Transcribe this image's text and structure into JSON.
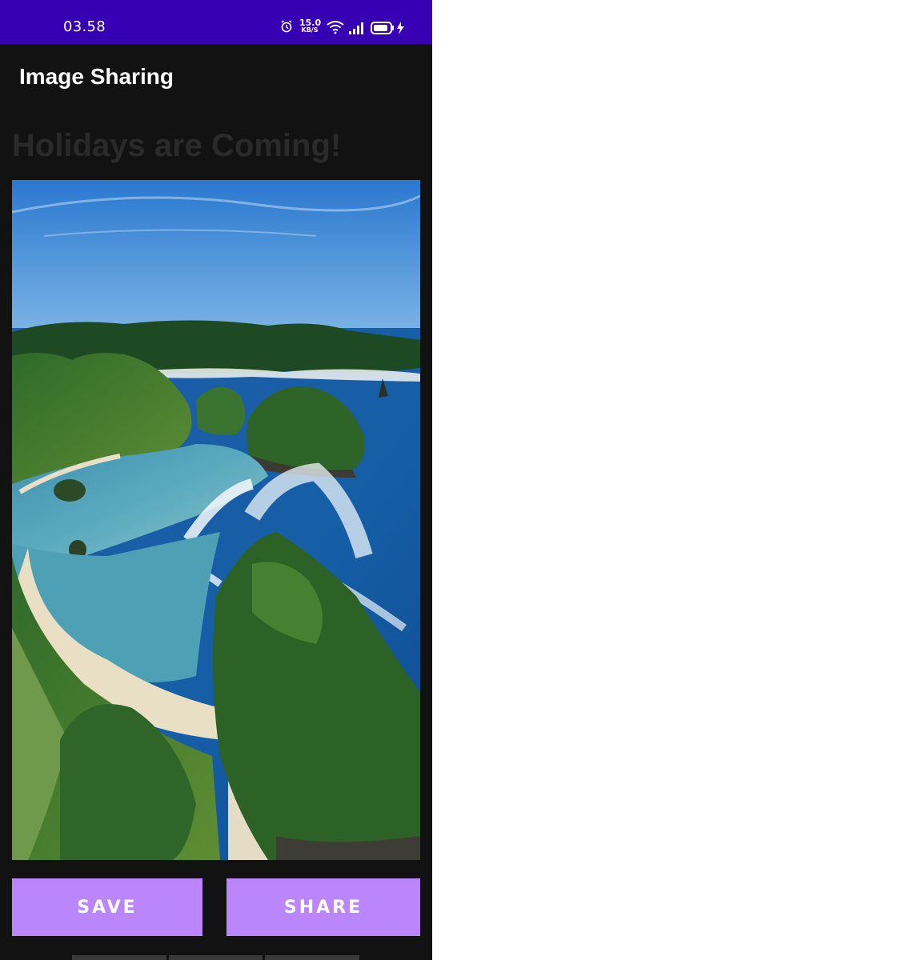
{
  "status_bar": {
    "time": "03.58",
    "net_speed_value": "15.0",
    "net_speed_unit": "KB/S",
    "icons": [
      "alarm-icon",
      "wifi-icon",
      "signal-icon",
      "battery-charging-icon"
    ],
    "color": "#3700b3"
  },
  "app_bar": {
    "title": "Image Sharing"
  },
  "main": {
    "headline": "Holidays are Coming!",
    "photo_icon": "beach-island-photo"
  },
  "actions": {
    "save_label": "SAVE",
    "share_label": "SHARE",
    "color": "#bb86fc"
  },
  "background": "#121212"
}
